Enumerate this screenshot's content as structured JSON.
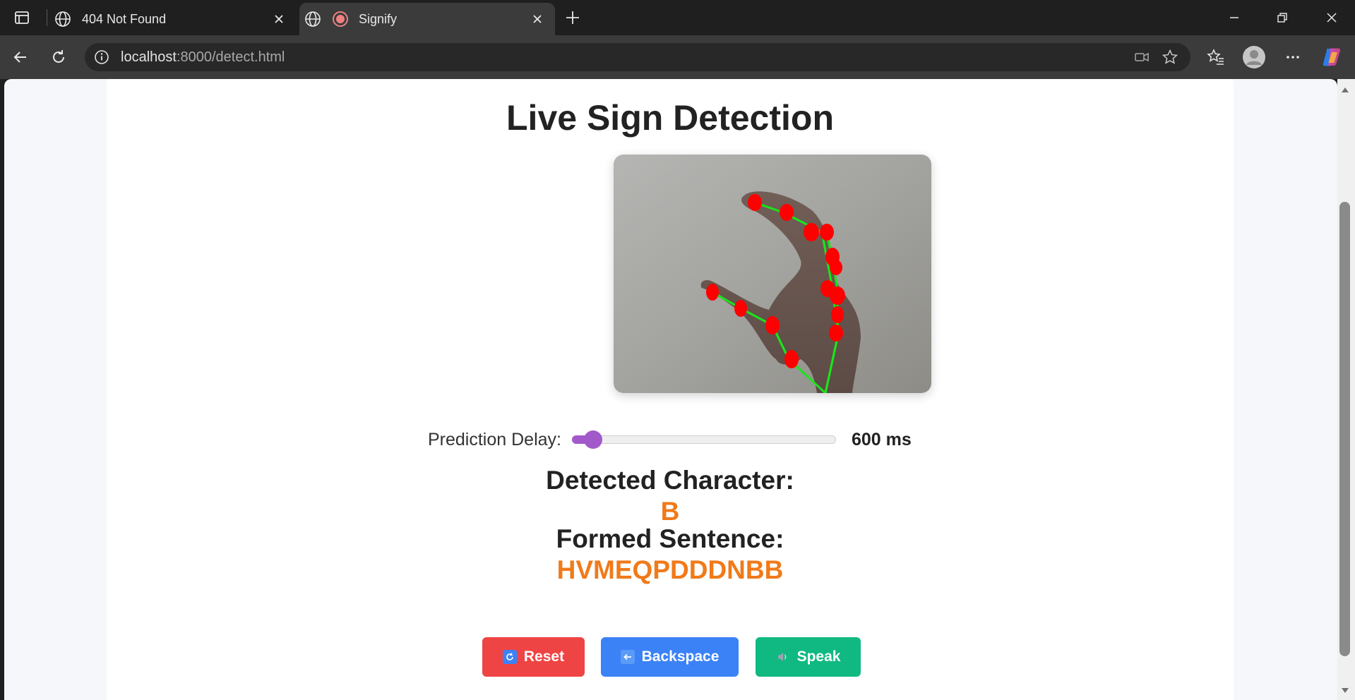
{
  "browser": {
    "tabs": [
      {
        "title": "404 Not Found",
        "icon": "globe-icon",
        "active": false
      },
      {
        "title": "Signify",
        "icon": "globe-icon",
        "active": true,
        "recording": true
      }
    ],
    "address": {
      "host": "localhost",
      "path": ":8000/detect.html"
    }
  },
  "page": {
    "heading": "Live Sign Detection",
    "video": {
      "alt": "Webcam feed with hand landmarks"
    },
    "delay": {
      "label": "Prediction Delay:",
      "value_text": "600 ms",
      "level": 0.05
    },
    "detected": {
      "label": "Detected Character:",
      "value": "B"
    },
    "sentence": {
      "label": "Formed Sentence:",
      "value": "HVMEQPDDDNBB"
    },
    "buttons": {
      "reset": "Reset",
      "backspace": "Backspace",
      "speak": "Speak"
    }
  },
  "colors": {
    "accent_orange": "#f07a1a",
    "slider": "#a259c9",
    "reset": "#ef4444",
    "backspace": "#3b82f6",
    "speak": "#10b981"
  }
}
